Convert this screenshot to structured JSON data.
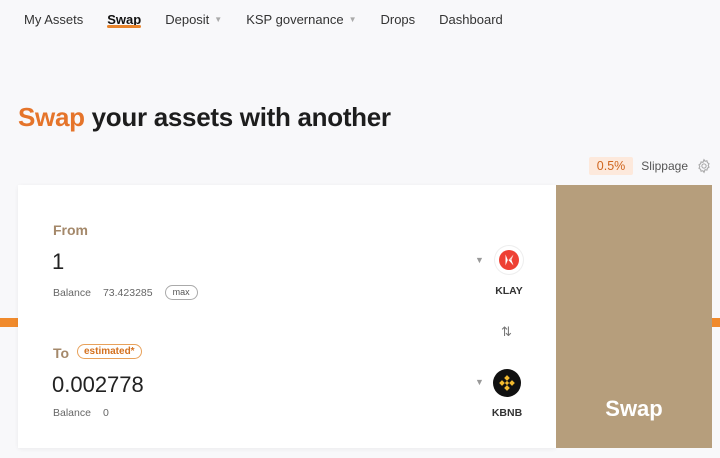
{
  "nav": {
    "items": [
      {
        "label": "My Assets"
      },
      {
        "label": "Swap"
      },
      {
        "label": "Deposit"
      },
      {
        "label": "KSP governance"
      },
      {
        "label": "Drops"
      },
      {
        "label": "Dashboard"
      }
    ]
  },
  "heading": {
    "accent": "Swap",
    "rest": " your assets with another"
  },
  "slippage": {
    "value": "0.5%",
    "label": "Slippage",
    "icon": "gear-icon"
  },
  "from": {
    "label": "From",
    "amount": "1",
    "balance_label": "Balance",
    "balance_value": "73.423285",
    "max_label": "max",
    "token": "KLAY",
    "token_icon": "klay-logo-icon"
  },
  "to": {
    "label": "To",
    "estimated_label": "estimated*",
    "amount": "0.002778",
    "balance_label": "Balance",
    "balance_value": "0",
    "token": "KBNB",
    "token_icon": "kbnb-logo-icon"
  },
  "swap_button": {
    "label": "Swap"
  },
  "colors": {
    "accent": "#e5742a",
    "swap_button": "#b69e7c",
    "label": "#a4886a",
    "orange_line": "#f08a2c"
  }
}
